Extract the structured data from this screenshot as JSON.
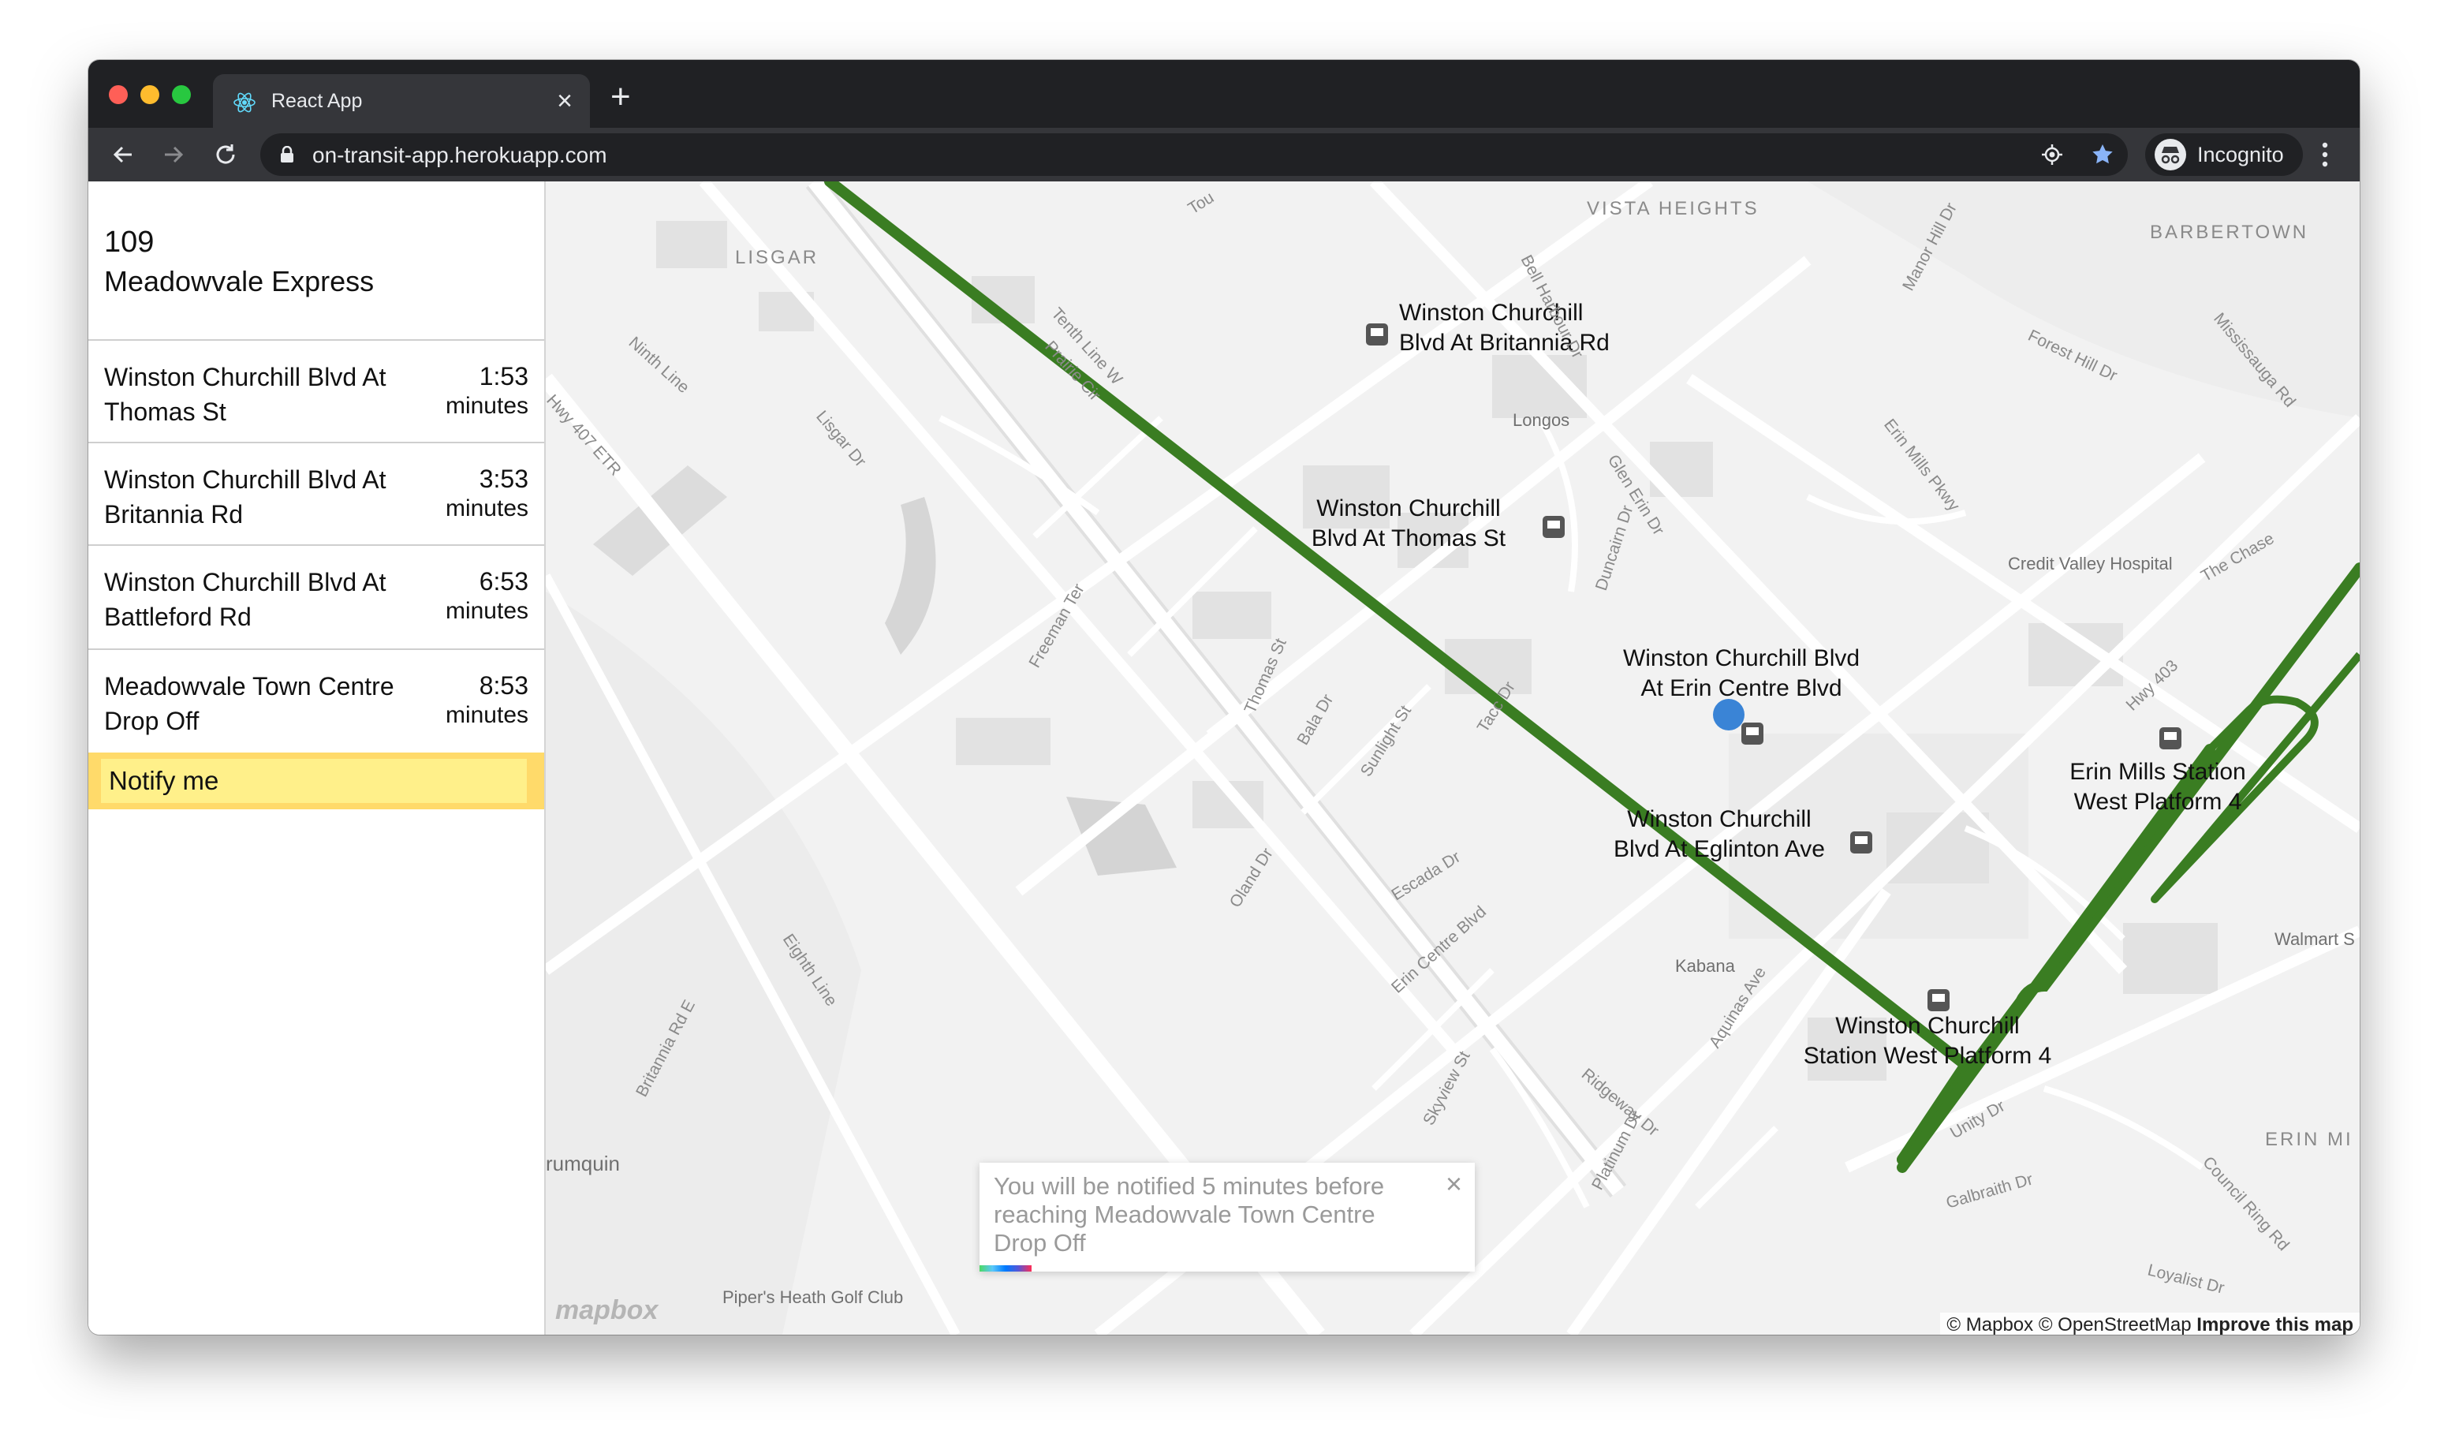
{
  "browser": {
    "tab_title": "React App",
    "url": "on-transit-app.herokuapp.com",
    "profile_label": "Incognito"
  },
  "sidebar": {
    "route_number": "109",
    "route_name": "Meadowvale Express",
    "stops": [
      {
        "name": "Winston Churchill Blvd At Thomas St",
        "time": "1:53",
        "unit": "minutes"
      },
      {
        "name": "Winston Churchill Blvd At Britannia Rd",
        "time": "3:53",
        "unit": "minutes"
      },
      {
        "name": "Winston Churchill Blvd At Battleford Rd",
        "time": "6:53",
        "unit": "minutes"
      },
      {
        "name": "Meadowvale Town Centre Drop Off",
        "time": "8:53",
        "unit": "minutes"
      }
    ],
    "notify_label": "Notify me"
  },
  "map": {
    "route_color": "#3a7d22",
    "bus_dot_color": "#3a84d6",
    "stop_labels": [
      {
        "line1": "Winston Churchill",
        "line2": "Blvd At Britannia Rd"
      },
      {
        "line1": "Winston Churchill",
        "line2": "Blvd At Thomas St"
      },
      {
        "line1": "Winston Churchill Blvd",
        "line2": "At Erin Centre Blvd"
      },
      {
        "line1": "Winston Churchill",
        "line2": "Blvd At Eglinton Ave"
      },
      {
        "line1": "Winston Churchill",
        "line2": "Station West Platform 4"
      },
      {
        "line1": "Erin Mills Station",
        "line2": "West Platform 4"
      }
    ],
    "place_labels": [
      "LISGAR",
      "VISTA HEIGHTS",
      "BARBERTOWN",
      "ERIN MI",
      "Longos",
      "Credit Valley Hospital",
      "Kabana",
      "Walmart S",
      "rumquin",
      "Piper's Heath Golf Club"
    ],
    "street_labels": [
      "Ninth Line",
      "Hwy 407 ETR",
      "Lisgar Dr",
      "Tenth Line W",
      "Prairie Cir",
      "Bell Harbour Dr",
      "Manor Hill Dr",
      "Forest Hill Dr",
      "Mississauga Rd",
      "Erin Mills Pkwy",
      "Glen Erin Dr",
      "Duncairn Dr",
      "The Chase",
      "Freeman Ter",
      "Thomas St",
      "Bala Dr",
      "Sunlight St",
      "Tacc Dr",
      "Hwy 403",
      "Oland Dr",
      "Escada Dr",
      "Erin Centre Blvd",
      "Aquinas Ave",
      "Eighth Line",
      "Britannia Rd E",
      "Skyview St",
      "Ridgeway Dr",
      "Platinum Dr",
      "Unity Dr",
      "Galbraith Dr",
      "Council Ring Rd",
      "Loyalist Dr",
      "Tou"
    ],
    "toast_text": "You will be notified 5 minutes before reaching Meadowvale Town Centre Drop Off",
    "toast_close": "×",
    "logo_text": "mapbox",
    "attribution_a": "© Mapbox © OpenStreetMap",
    "attribution_b": "Improve this map"
  }
}
